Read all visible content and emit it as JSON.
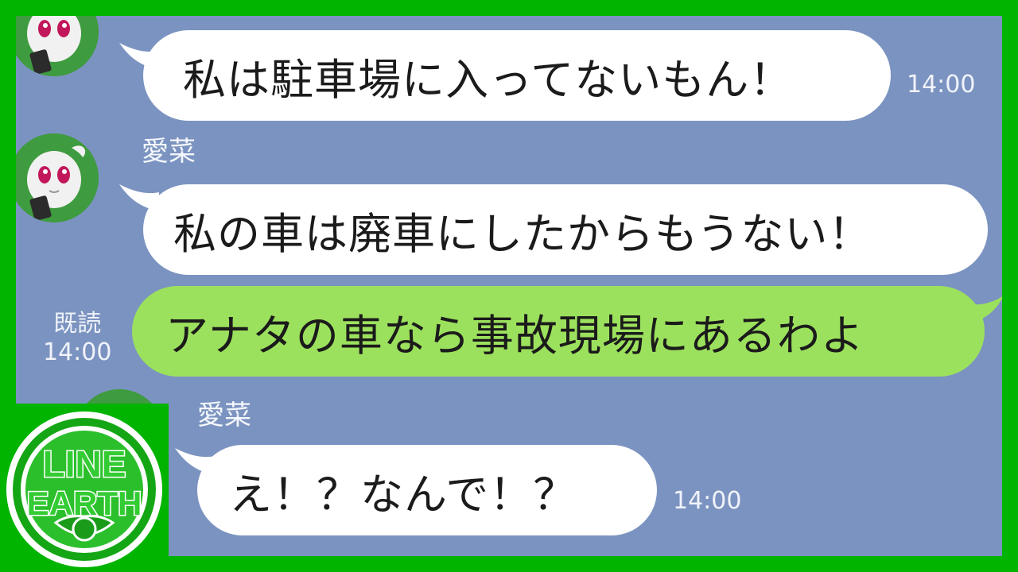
{
  "messages": [
    {
      "sender": "",
      "text": "私は駐車場に入ってないもん！",
      "time": "14:00"
    },
    {
      "sender": "愛菜",
      "text": "私の車は廃車にしたからもうない！",
      "time": ""
    },
    {
      "sender": "me",
      "text": "アナタの車なら事故現場にあるわよ",
      "read_label": "既読",
      "time": "14:00"
    },
    {
      "sender": "愛菜",
      "text": "え！？なんで！？",
      "time": "14:00"
    }
  ],
  "logo": {
    "line1": "LINE",
    "line2": "EARTH"
  },
  "colors": {
    "frame": "#00b400",
    "chat_background": "#7b93c0",
    "incoming_bubble": "#ffffff",
    "outgoing_bubble": "#9ce15d"
  }
}
